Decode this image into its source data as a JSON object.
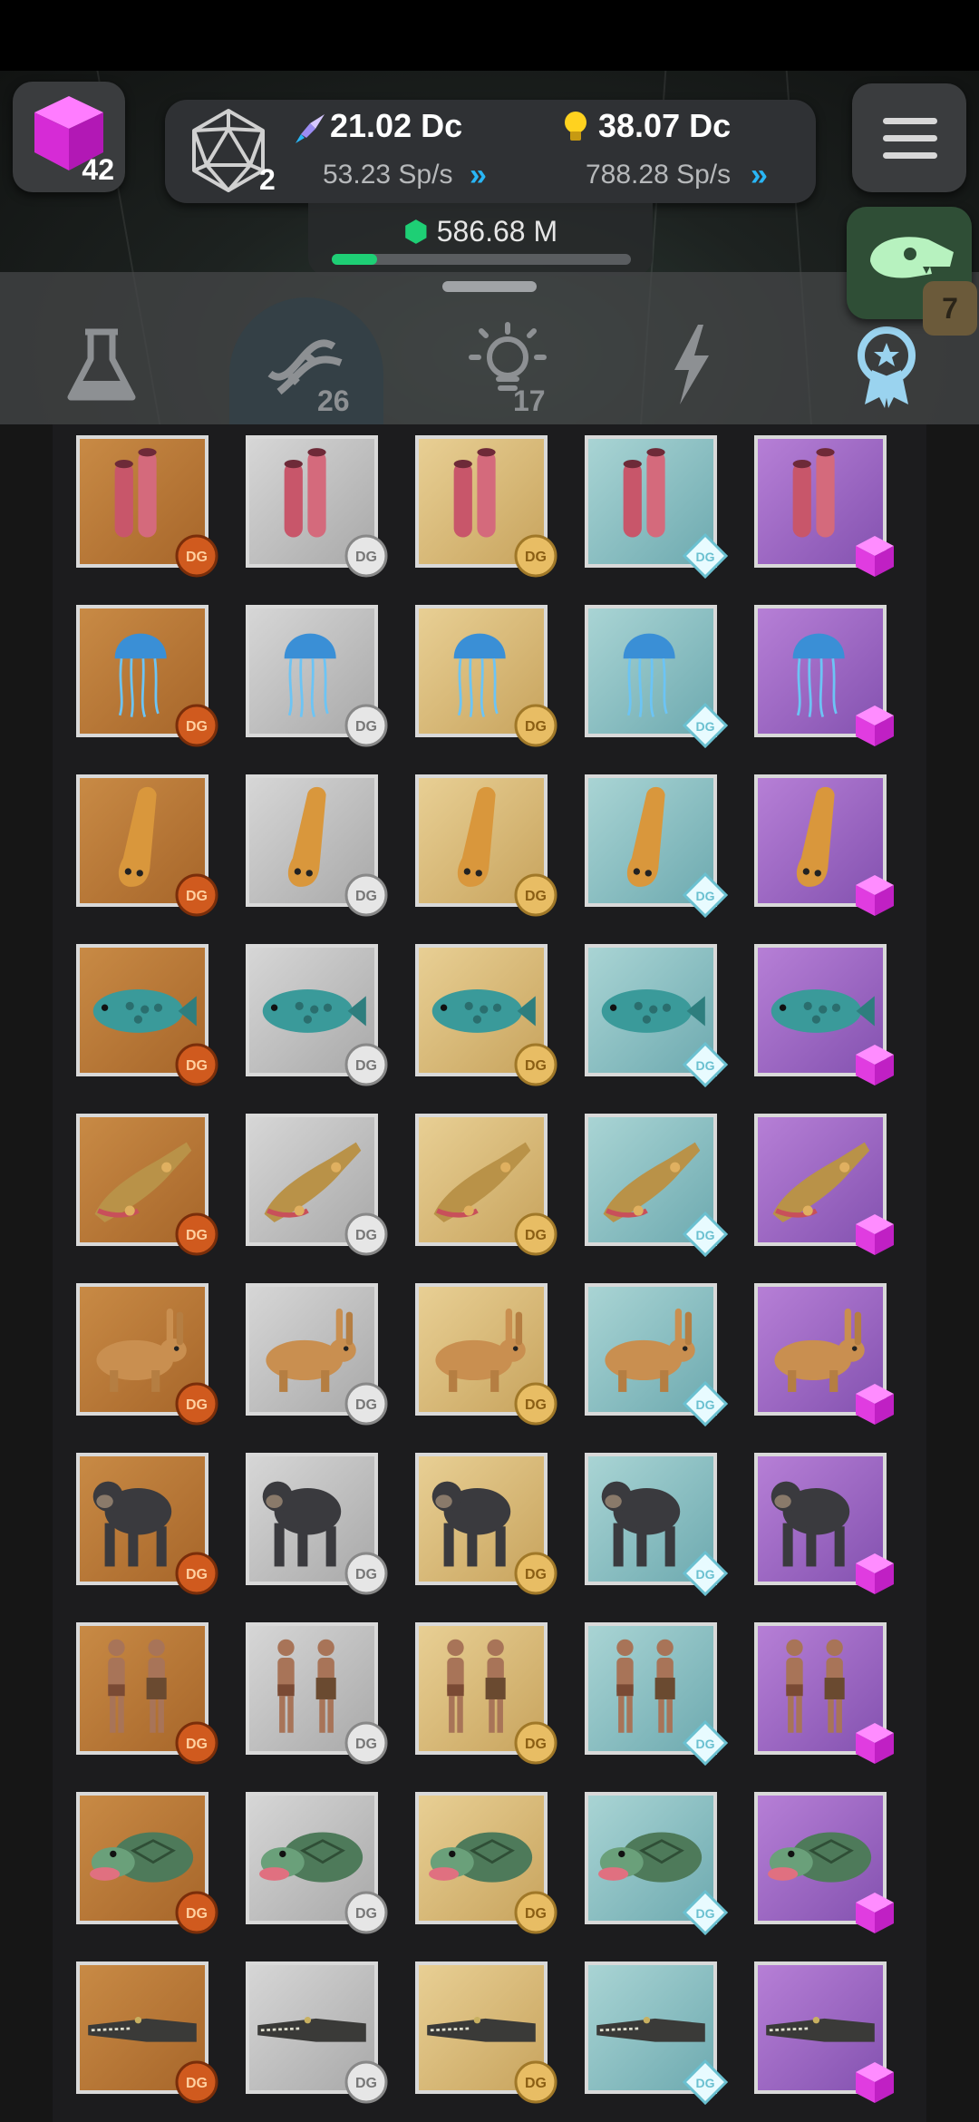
{
  "top_left": {
    "cube_count": "42",
    "icon": "magenta-cube-icon"
  },
  "stats": {
    "level": "2",
    "resource1": {
      "value": "21.02 Dc",
      "rate": "53.23 Sp/s",
      "icon": "rocket-icon"
    },
    "resource2": {
      "value": "38.07 Dc",
      "rate": "788.28 Sp/s",
      "icon": "lightbulb-icon"
    }
  },
  "gem_progress": {
    "value": "586.68 M",
    "fraction": 0.15,
    "icon": "green-gem-icon"
  },
  "dino_button": {
    "badge": "7",
    "icon": "dinosaur-skull-icon"
  },
  "tabs": [
    {
      "id": "lab",
      "icon": "flask-icon",
      "count": ""
    },
    {
      "id": "dna",
      "icon": "dna-icon",
      "count": "26",
      "active": true
    },
    {
      "id": "ideas",
      "icon": "lightbulb-icon",
      "count": "17"
    },
    {
      "id": "boost",
      "icon": "lightning-icon",
      "count": ""
    },
    {
      "id": "awards",
      "icon": "award-ribbon-icon",
      "count": ""
    }
  ],
  "tiers": [
    "bronze",
    "silver",
    "gold",
    "diamond",
    "cube"
  ],
  "creatures": [
    "tube-sponge",
    "jellyfish",
    "worm",
    "fish",
    "amphibian",
    "rabbit",
    "chimpanzee",
    "early-humans",
    "turtle",
    "crocodile"
  ],
  "colors": {
    "bronze": "#b87838",
    "silver": "#c0c0c0",
    "gold": "#d8bb78",
    "diamond": "#8cc0c4",
    "cube": "#9d68c4",
    "accent": "#1ecf75"
  }
}
